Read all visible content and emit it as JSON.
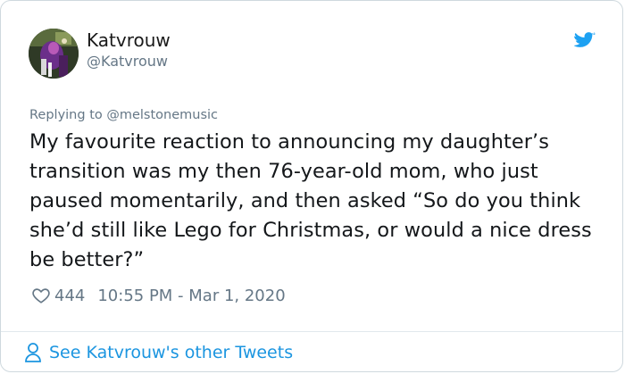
{
  "author": {
    "display_name": "Katvrouw",
    "handle": "@Katvrouw",
    "avatar_icon": "avatar-image"
  },
  "reply": {
    "prefix": "Replying to ",
    "mention": "@melstonemusic"
  },
  "tweet": {
    "text": "My favourite reaction to announcing my daughter’s transition was my then 76-year-old mom, who just paused momentarily, and then asked “So do you think she’d still like Lego for Christmas, or would a nice dress be better?”"
  },
  "meta": {
    "likes": "444",
    "timestamp": "10:55 PM - Mar 1, 2020"
  },
  "footer": {
    "see_other_label": "See Katvrouw's other Tweets"
  },
  "icons": {
    "bird": "twitter-bird-icon",
    "heart": "heart-icon",
    "person": "person-icon"
  },
  "colors": {
    "brand_blue": "#1da1f2",
    "link_blue": "#1b95e0",
    "muted_gray": "#657786",
    "text_dark": "#14171a"
  }
}
